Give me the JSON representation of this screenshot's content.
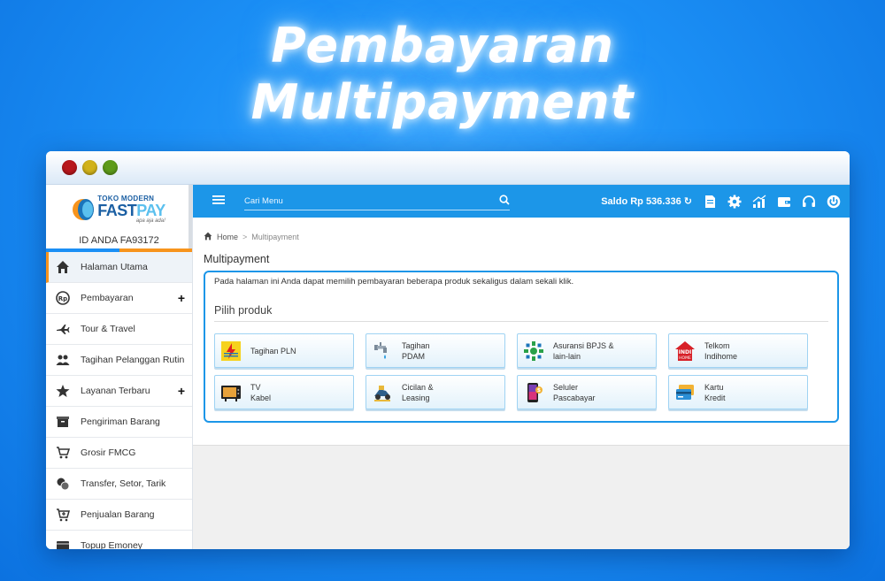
{
  "hero": {
    "line1": "Pembayaran",
    "line2": "Multipayment"
  },
  "sidebar": {
    "logo": {
      "top": "TOKO MODERN",
      "main_a": "FAST",
      "main_b": "PAY",
      "tagline": "apa aja ada!"
    },
    "user_id": "ID ANDA FA93172",
    "items": [
      {
        "label": "Halaman Utama",
        "icon": "home-icon",
        "active": true,
        "expand": ""
      },
      {
        "label": "Pembayaran",
        "icon": "payment-icon",
        "expand": "+"
      },
      {
        "label": "Tour & Travel",
        "icon": "plane-icon",
        "expand": ""
      },
      {
        "label": "Tagihan Pelanggan Rutin",
        "icon": "users-icon",
        "expand": ""
      },
      {
        "label": "Layanan Terbaru",
        "icon": "star-icon",
        "expand": "+"
      },
      {
        "label": "Pengiriman Barang",
        "icon": "box-icon",
        "expand": ""
      },
      {
        "label": "Grosir FMCG",
        "icon": "cart-icon",
        "expand": ""
      },
      {
        "label": "Transfer, Setor, Tarik",
        "icon": "coins-icon",
        "expand": ""
      },
      {
        "label": "Penjualan Barang",
        "icon": "cart-plus-icon",
        "expand": ""
      },
      {
        "label": "Topup Emoney",
        "icon": "card-icon",
        "expand": ""
      }
    ]
  },
  "topbar": {
    "search_placeholder": "Cari Menu",
    "saldo": "Saldo Rp 536.336"
  },
  "breadcrumb": {
    "home": "Home",
    "sep": ">",
    "current": "Multipayment"
  },
  "page": {
    "title": "Multipayment",
    "description": "Pada halaman ini Anda dapat memilih pembayaran beberapa produk sekaligus dalam sekali klik.",
    "section_title": "Pilih produk"
  },
  "products": [
    {
      "line1": "Tagihan PLN",
      "line2": "",
      "icon": "pln-icon"
    },
    {
      "line1": "Tagihan",
      "line2": "PDAM",
      "icon": "water-tap-icon"
    },
    {
      "line1": "Asuransi BPJS &",
      "line2": "lain-lain",
      "icon": "bpjs-icon"
    },
    {
      "line1": "Telkom",
      "line2": "Indihome",
      "icon": "indihome-icon"
    },
    {
      "line1": "TV",
      "line2": "Kabel",
      "icon": "tv-icon"
    },
    {
      "line1": "Cicilan &",
      "line2": "Leasing",
      "icon": "leasing-icon"
    },
    {
      "line1": "Seluler",
      "line2": "Pascabayar",
      "icon": "phone-icon"
    },
    {
      "line1": "Kartu",
      "line2": "Kredit",
      "icon": "credit-card-icon"
    }
  ],
  "colors": {
    "primary": "#1c96e8",
    "accent": "#f7941d",
    "brand": "#1b5fa3"
  }
}
